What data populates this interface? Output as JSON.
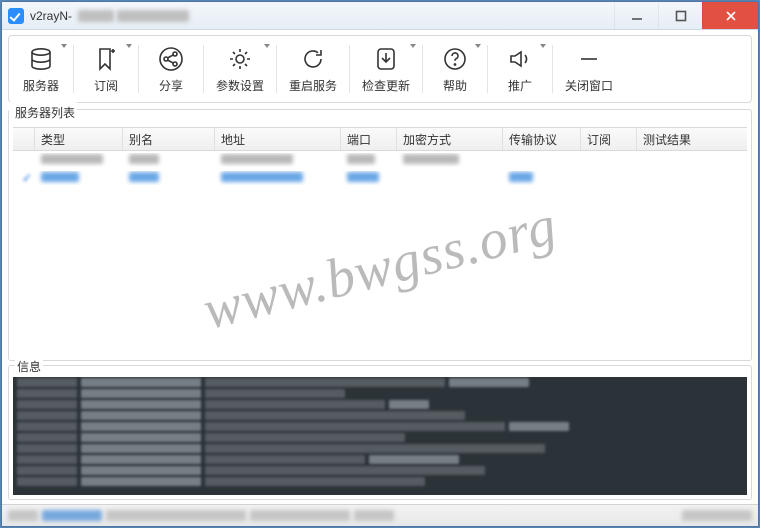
{
  "title": {
    "app": "v2rayN",
    "sep": " - "
  },
  "toolbar": {
    "servers": "服务器",
    "subscribe": "订阅",
    "share": "分享",
    "settings": "参数设置",
    "restart": "重启服务",
    "update": "检查更新",
    "help": "帮助",
    "promote": "推广",
    "close": "关闭窗口"
  },
  "serverlist": {
    "caption": "服务器列表",
    "columns": {
      "type": "类型",
      "alias": "别名",
      "address": "地址",
      "port": "端口",
      "encryption": "加密方式",
      "transport": "传输协议",
      "sub": "订阅",
      "test": "测试结果"
    }
  },
  "infopanel": {
    "caption": "信息"
  },
  "watermark": "www.bwgss.org"
}
